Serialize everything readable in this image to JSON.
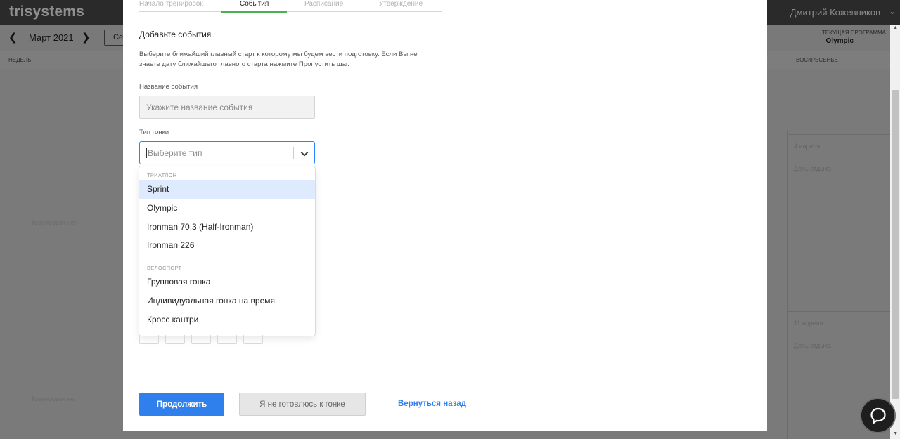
{
  "app": {
    "logo": "trisystems",
    "user_name": "Дмитрий Кожевников",
    "month": "Март 2021",
    "today_button": "Се",
    "program_label": "ТЕКУЩАЯ ПРОГРАММА",
    "program_value": "Olympic",
    "weekday_left": "НЕДЕЛЬ",
    "weekday_right": "ВОСКРЕСЕНЬЕ",
    "calendar": {
      "cell1_date": "4 апреля",
      "cell1_status": "День отдыха",
      "cell2_date": "11 апреля",
      "cell2_status": "День отдыха",
      "no_training_1": "Тренировок нет",
      "no_training_2": "Тренировок нет"
    }
  },
  "modal": {
    "steps": [
      {
        "label": "Начало тренировок",
        "active": false
      },
      {
        "label": "События",
        "active": true
      },
      {
        "label": "Расписание",
        "active": false
      },
      {
        "label": "Утверждение",
        "active": false
      }
    ],
    "title": "Добавьте события",
    "description": "Выберите ближайший главный старт к которому мы будем вести подготовку. Если Вы не знаете дату ближайшего главного старта нажмите Пропустить шаг.",
    "event_name": {
      "label": "Название события",
      "placeholder": "Укажите название события",
      "value": ""
    },
    "race_type": {
      "label": "Тип гонки",
      "placeholder": "Выберите тип"
    },
    "menu": {
      "groups": [
        {
          "header": "ТРИАТЛОН",
          "options": [
            "Sprint",
            "Olympic",
            "Ironman 70.3 (Half-Ironman)",
            "Ironman 226"
          ]
        },
        {
          "header": "ВЕЛОСПОРТ",
          "options": [
            "Групповая гонка",
            "Индивидуальная гонка на время",
            "Кросс кантри"
          ]
        }
      ],
      "highlighted": "Sprint"
    },
    "buttons": {
      "continue": "Продолжить",
      "skip": "Я не готовлюсь к гонке",
      "back": "Вернуться назад"
    }
  },
  "colors": {
    "primary": "#2f80ed",
    "step_active": "#4caf50",
    "option_highlight": "#deebff",
    "focus_border": "#2684ff"
  },
  "icons": [
    "chevron-left-icon",
    "chevron-right-icon",
    "chevron-down-icon",
    "chat-icon"
  ]
}
